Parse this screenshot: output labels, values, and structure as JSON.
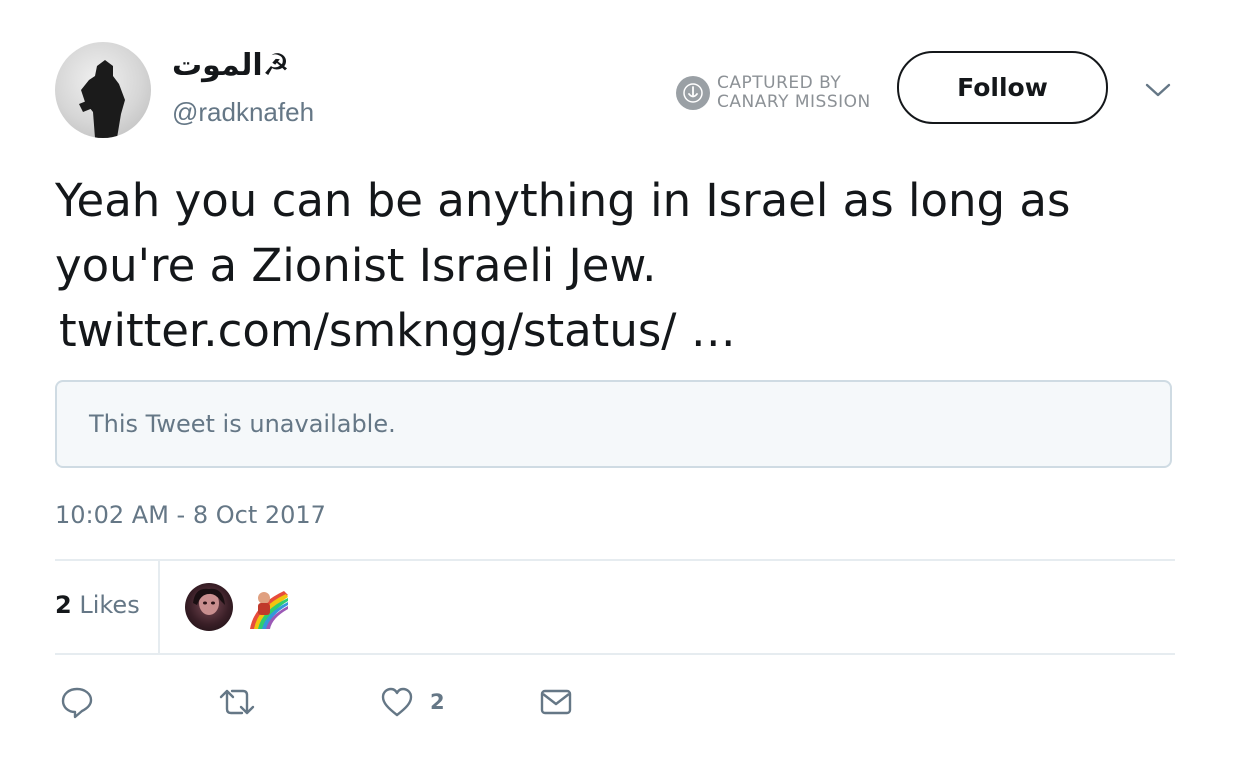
{
  "tweet": {
    "display_name": "الموت☭",
    "handle": "@radknafeh",
    "text": "Yeah you can be anything in Israel as long as you're a Zionist Israeli Jew.",
    "link": "twitter.com/smkngg/status/ …",
    "quoted_tweet_message": "This Tweet is unavailable.",
    "timestamp": "10:02 AM - 8 Oct 2017"
  },
  "header": {
    "captured_line1": "CAPTURED BY",
    "captured_line2": "CANARY MISSION",
    "follow_label": "Follow"
  },
  "stats": {
    "likes_count": "2",
    "likes_label": "Likes"
  },
  "actions": {
    "reply_icon": "reply-icon",
    "retweet_icon": "retweet-icon",
    "like_icon": "heart-icon",
    "like_count": "2",
    "message_icon": "envelope-icon"
  },
  "colors": {
    "text_primary": "#14171a",
    "text_secondary": "#657786",
    "divider": "#e6ecf0",
    "quote_bg": "#f5f8fa",
    "quote_border": "#cfdbe3"
  }
}
